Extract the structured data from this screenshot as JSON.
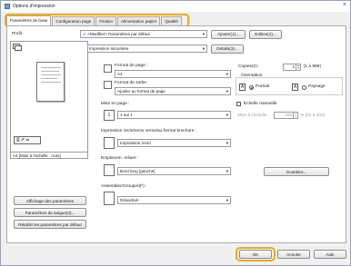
{
  "window": {
    "title": "Options d'impression",
    "close_glyph": "×"
  },
  "tabs": [
    {
      "label": "Paramètres de base"
    },
    {
      "label": "Configuration page"
    },
    {
      "label": "Finition"
    },
    {
      "label": "Alimentation papier"
    },
    {
      "label": "Qualité"
    }
  ],
  "profile": {
    "label": "Profil :",
    "value": "<Modifier> Paramètres par défaut",
    "add_button": "Ajouter(1)...",
    "edit_button": "Edition(2)..."
  },
  "output": {
    "label": "Méthode de sortie :",
    "value": "Impression sécurisée",
    "details_button": "Détails(3)..."
  },
  "preview": {
    "status": "A4 [Mise à l'échelle : Auto]"
  },
  "page_format": {
    "label": "Format de page :",
    "value": "A4"
  },
  "output_format": {
    "label": "Format de sortie :",
    "value": "Ajuster au format de page"
  },
  "layout": {
    "label": "Mise en page :",
    "value": "1 sur 1"
  },
  "duplex": {
    "label": "Impression recto/recto verso/au format brochure :",
    "value": "Impression recto"
  },
  "binding": {
    "label": "Emplacem. reliure :",
    "value": "Bord long [gauche]",
    "gutter_button": "Gouttière..."
  },
  "finishing": {
    "label": "Assembler/Grouper(F) :",
    "value": "Désactivé"
  },
  "copies": {
    "label": "Copies(2) :",
    "value": "1",
    "range": "[1 à 999]"
  },
  "orientation": {
    "label": "Orientation",
    "portrait": "Portrait",
    "landscape": "Paysage",
    "selected": "portrait"
  },
  "scaling": {
    "checkbox_label": "Échelle manuelle",
    "label": "Mise à l'échelle :",
    "value": "100",
    "range": "% [25 à 200]"
  },
  "side_buttons": {
    "show_settings": "Affichage des paramètres",
    "language": "Paramètres de langue(3)...",
    "restore": "Rétablir les paramètres par défaut"
  },
  "footer": {
    "ok": "OK",
    "cancel": "Annuler",
    "help": "Aide"
  }
}
